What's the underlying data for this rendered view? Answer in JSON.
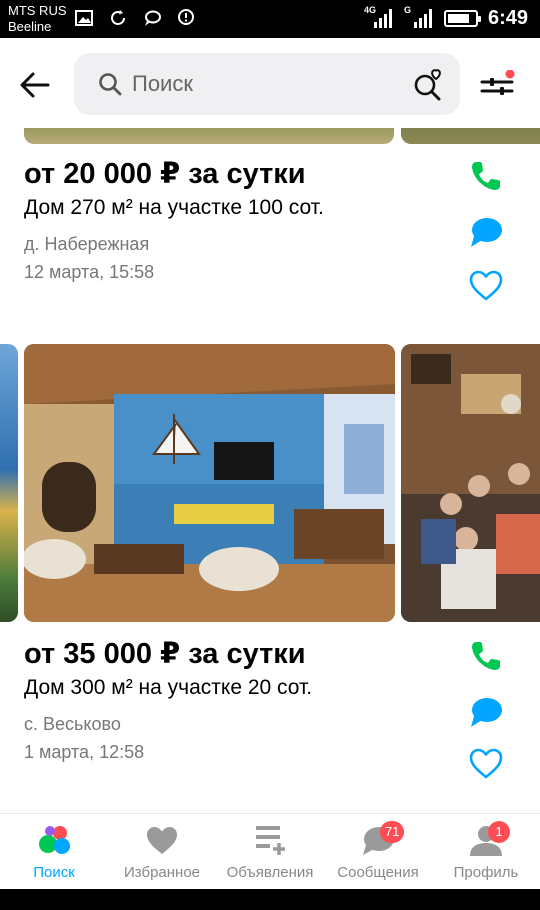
{
  "status_bar": {
    "carrier_1": "MTS RUS",
    "carrier_2": "Beeline",
    "network_1": "4G",
    "network_2": "G",
    "time": "6:49"
  },
  "header": {
    "search_placeholder": "Поиск"
  },
  "listings": [
    {
      "price": "от 20 000 ₽ за сутки",
      "description": "Дом 270 м² на участке 100 сот.",
      "location": "д. Набережная",
      "date": "12 марта, 15:58"
    },
    {
      "price": "от 35 000 ₽ за сутки",
      "description": "Дом 300 м² на участке 20 сот.",
      "location": "с. Веськово",
      "date": "1 марта, 12:58"
    }
  ],
  "bottom_nav": {
    "items": [
      {
        "label": "Поиск",
        "icon": "search-dots-icon",
        "active": true
      },
      {
        "label": "Избранное",
        "icon": "heart-icon"
      },
      {
        "label": "Объявления",
        "icon": "ads-list-icon"
      },
      {
        "label": "Сообщения",
        "icon": "chat-icon",
        "badge": "71"
      },
      {
        "label": "Профиль",
        "icon": "profile-icon",
        "badge": "1"
      }
    ]
  },
  "colors": {
    "accent": "#00a6ff",
    "call_green": "#00c752",
    "chat_blue": "#02a5ff",
    "badge_red": "#ff4d55"
  }
}
